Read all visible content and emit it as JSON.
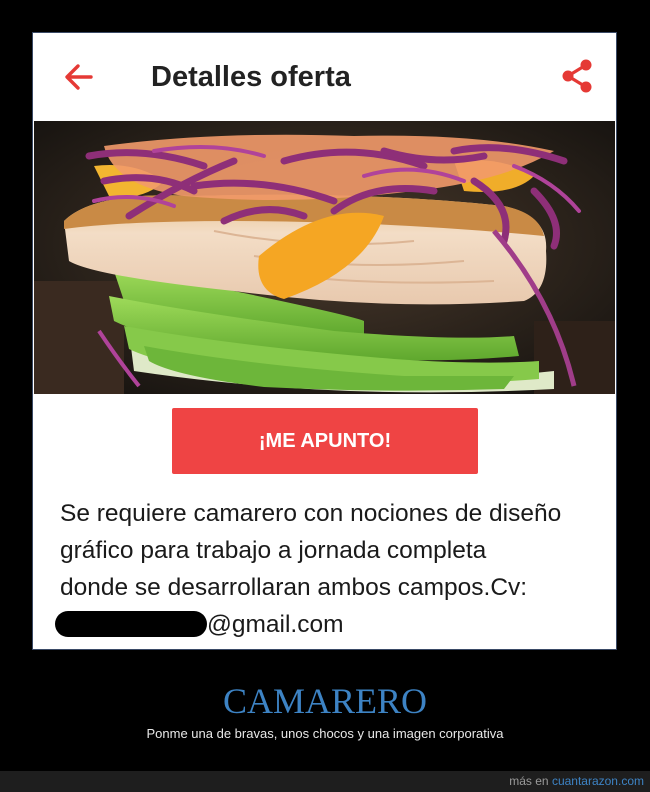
{
  "header": {
    "title": "Detalles oferta",
    "back_icon": "arrow-left-icon",
    "share_icon": "share-icon",
    "accent_color": "#e53935"
  },
  "offer": {
    "image": "food-photo",
    "cta_label": "¡ME APUNTO!",
    "cta_color": "#ef4444",
    "description_lines": [
      "Se requiere camarero con nociones de diseño",
      "gráfico para trabajo a jornada completa",
      "donde se desarrollaran ambos campos.Cv:"
    ],
    "email_suffix": "@gmail.com"
  },
  "caption": {
    "title": "CAMARERO",
    "subtitle": "Ponme una de bravas, unos chocos y una imagen corporativa",
    "title_color": "#3d83c4"
  },
  "footer": {
    "prefix": "más en",
    "link": "cuantarazon.com"
  }
}
